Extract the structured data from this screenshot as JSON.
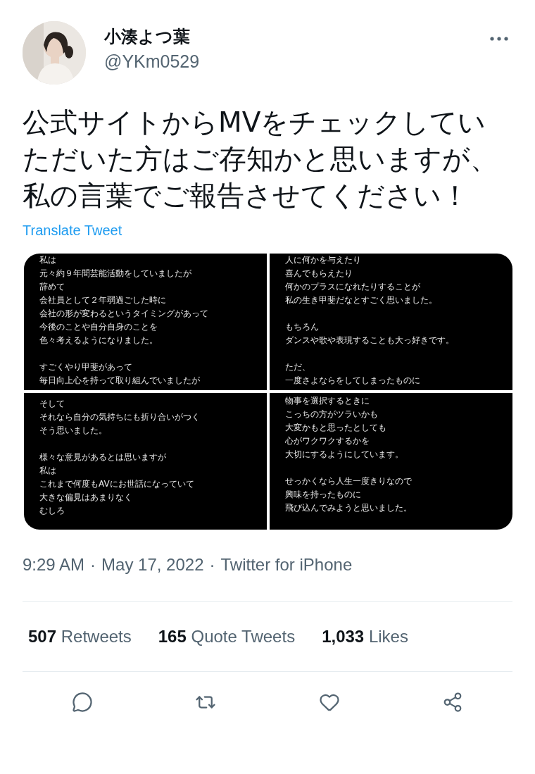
{
  "author": {
    "name": "小湊よつ葉",
    "handle": "@YKm0529"
  },
  "tweet_text": "公式サイトからMVをチェックしていただいた方はご存知かと思いますが、私の言葉でご報告させてください！",
  "translate_link": "Translate Tweet",
  "images": [
    {
      "paragraphs": [
        [
          "私は",
          "元々約９年間芸能活動をしていましたが",
          "辞めて",
          "会社員として２年弱過ごした時に",
          "会社の形が変わるというタイミングがあって",
          "今後のことや自分自身のことを",
          "色々考えるようになりました。"
        ],
        [
          "すごくやり甲斐があって",
          "毎日向上心を持って取り組んでいましたが"
        ]
      ]
    },
    {
      "paragraphs": [
        [
          "人に何かを与えたり",
          "喜んでもらえたり",
          "何かのプラスになれたりすることが",
          "私の生き甲斐だなとすごく思いました。"
        ],
        [
          "もちろん",
          "ダンスや歌や表現することも大っ好きです。"
        ],
        [
          "ただ、",
          "一度さよならをしてしまったものに"
        ]
      ]
    },
    {
      "paragraphs": [
        [
          "そして",
          "それなら自分の気持ちにも折り合いがつく",
          "そう思いました。"
        ],
        [
          "様々な意見があるとは思いますが",
          "私は",
          "これまで何度もAVにお世話になっていて",
          "大きな偏見はあまりなく",
          "むしろ"
        ]
      ]
    },
    {
      "paragraphs": [
        [
          "物事を選択するときに",
          "こっちの方がツラいかも",
          "大変かもと思ったとしても",
          "心がワクワクするかを",
          "大切にするようにしています。"
        ],
        [
          "せっかくなら人生一度きりなので",
          "興味を持ったものに",
          "飛び込んでみようと思いました。"
        ]
      ]
    }
  ],
  "meta": {
    "time": "9:29 AM",
    "separator_1": "·",
    "date": "May 17, 2022",
    "separator_2": "·",
    "source": "Twitter for iPhone"
  },
  "stats": [
    {
      "count": "507",
      "label": "Retweets"
    },
    {
      "count": "165",
      "label": "Quote Tweets"
    },
    {
      "count": "1,033",
      "label": "Likes"
    }
  ],
  "actions": [
    {
      "kind": "reply"
    },
    {
      "kind": "retweet"
    },
    {
      "kind": "like"
    },
    {
      "kind": "share"
    }
  ]
}
